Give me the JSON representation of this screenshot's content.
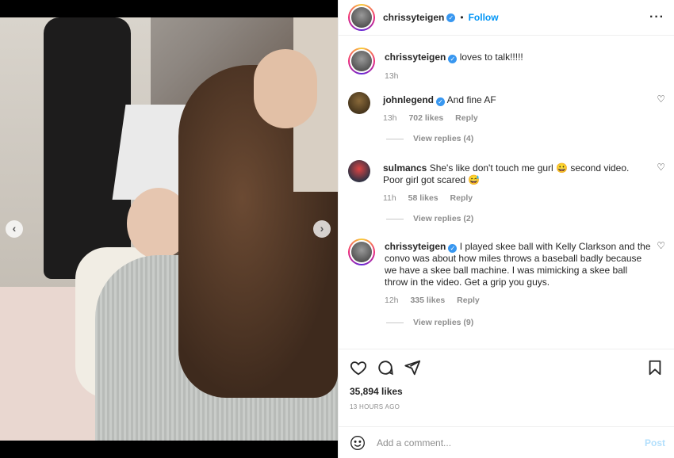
{
  "colors": {
    "accent": "#0095f6",
    "verified": "#3897f0",
    "muted": "#8e8e8e"
  },
  "media": {
    "icons": {
      "prev": "chevron-left-icon",
      "next": "chevron-right-icon"
    },
    "prev_glyph": "‹",
    "next_glyph": "›"
  },
  "header": {
    "username": "chrissyteigen",
    "separator": "•",
    "follow_label": "Follow",
    "more_glyph": "···"
  },
  "caption": {
    "username": "chrissyteigen",
    "text": "loves to talk!!!!!",
    "time": "13h"
  },
  "comments": [
    {
      "username": "johnlegend",
      "text": "And fine AF",
      "time": "13h",
      "likes": "702 likes",
      "reply_label": "Reply",
      "view_replies": "View replies (4)"
    },
    {
      "username": "sulmancs",
      "text": "She's like don't touch me gurl 😀 second video. Poor girl got scared 😅",
      "time": "11h",
      "likes": "58 likes",
      "reply_label": "Reply",
      "view_replies": "View replies (2)"
    },
    {
      "username": "chrissyteigen",
      "text": "I played skee ball with Kelly Clarkson and the convo was about how miles throws a baseball badly because we have a skee ball machine. I was mimicking a skee ball throw in the video. Get a grip you guys.",
      "time": "12h",
      "likes": "335 likes",
      "reply_label": "Reply",
      "view_replies": "View replies (9)"
    }
  ],
  "actions": {
    "icons": [
      "heart-icon",
      "comment-icon",
      "share-icon",
      "bookmark-icon"
    ],
    "likes": "35,894 likes",
    "ago": "13 HOURS AGO"
  },
  "add_comment": {
    "placeholder": "Add a comment...",
    "post_label": "Post"
  }
}
